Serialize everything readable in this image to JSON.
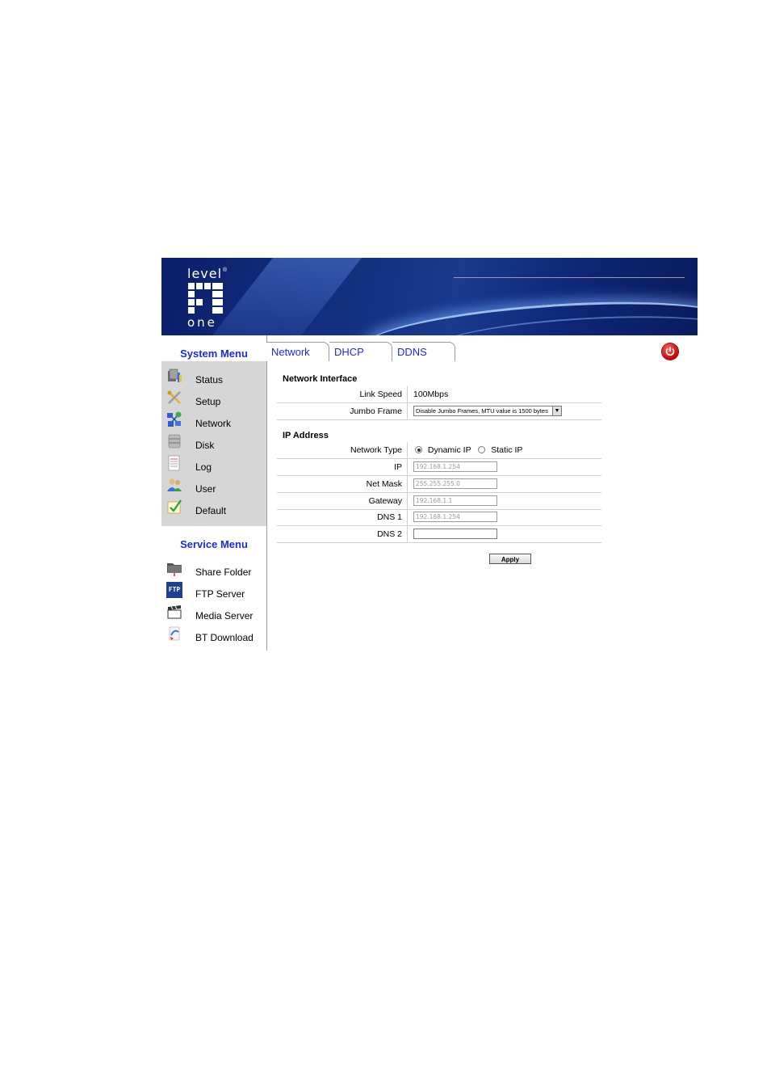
{
  "brand": {
    "logo_top": "level",
    "logo_reg": "®",
    "logo_bottom": "one"
  },
  "sidebar": {
    "system_menu_title": "System Menu",
    "system_items": [
      {
        "label": "Status",
        "icon": "status-icon"
      },
      {
        "label": "Setup",
        "icon": "tools-icon"
      },
      {
        "label": "Network",
        "icon": "network-icon"
      },
      {
        "label": "Disk",
        "icon": "disk-icon"
      },
      {
        "label": "Log",
        "icon": "log-icon"
      },
      {
        "label": "User",
        "icon": "users-icon"
      },
      {
        "label": "Default",
        "icon": "default-icon"
      }
    ],
    "service_menu_title": "Service Menu",
    "service_items": [
      {
        "label": "Share Folder",
        "icon": "folder-icon"
      },
      {
        "label": "FTP Server",
        "icon": "ftp-icon",
        "icon_text": "FTP"
      },
      {
        "label": "Media Server",
        "icon": "clapperboard-icon"
      },
      {
        "label": "BT Download",
        "icon": "download-icon"
      }
    ]
  },
  "tabs": [
    {
      "label": "Network",
      "active": true
    },
    {
      "label": "DHCP",
      "active": false
    },
    {
      "label": "DDNS",
      "active": false
    }
  ],
  "form": {
    "network_interface_title": "Network Interface",
    "link_speed_label": "Link Speed",
    "link_speed_value": "100Mbps",
    "jumbo_frame_label": "Jumbo Frame",
    "jumbo_frame_value": "Disable Jumbo Frames, MTU value is 1500 bytes",
    "ip_address_title": "IP Address",
    "network_type_label": "Network Type",
    "network_type_options": [
      "Dynamic IP",
      "Static IP"
    ],
    "network_type_selected": "Dynamic IP",
    "ip_label": "IP",
    "ip_value": "192.168.1.254",
    "netmask_label": "Net Mask",
    "netmask_value": "255.255.255.0",
    "gateway_label": "Gateway",
    "gateway_value": "192.168.1.1",
    "dns1_label": "DNS 1",
    "dns1_value": "192.168.1.254",
    "dns2_label": "DNS 2",
    "dns2_value": "",
    "apply_label": "Apply"
  },
  "colors": {
    "menu_title": "#1a2bd8",
    "banner_dark": "#0b1f6b",
    "sidebar_bg": "#d6d6d6",
    "power_button": "#c40000"
  }
}
